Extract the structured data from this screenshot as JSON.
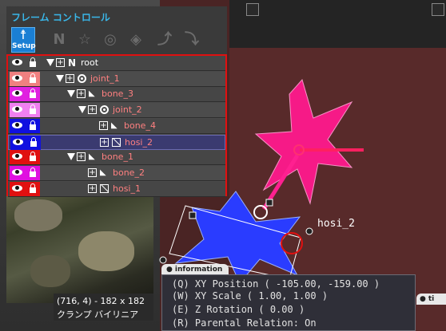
{
  "panel": {
    "title": "フレーム コントロール",
    "setup_label": "Setup",
    "toolbar_icons": [
      "new-null-icon",
      "new-star-icon",
      "new-joint-icon",
      "new-bone-icon",
      "import-icon",
      "export-icon"
    ]
  },
  "tree": {
    "rows": [
      {
        "label": "root",
        "type": "null",
        "color": "#4a4a4a",
        "text": "#ffffff",
        "expanded": true
      },
      {
        "label": "joint_1",
        "type": "joint",
        "color": "#f08080",
        "text": "#ff8080",
        "expanded": true
      },
      {
        "label": "bone_3",
        "type": "bone",
        "color": "#e020e0",
        "text": "#ff8080",
        "expanded": true
      },
      {
        "label": "joint_2",
        "type": "joint",
        "color": "#f080f0",
        "text": "#ff8080",
        "expanded": true
      },
      {
        "label": "bone_4",
        "type": "bone",
        "color": "#1010e0",
        "text": "#ff8080",
        "expanded": false
      },
      {
        "label": "hosi_2",
        "type": "mesh",
        "color": "#1010e0",
        "text": "#ff8080",
        "expanded": false,
        "selected": true
      },
      {
        "label": "bone_1",
        "type": "bone",
        "color": "#e01010",
        "text": "#ff8080",
        "expanded": true
      },
      {
        "label": "bone_2",
        "type": "bone",
        "color": "#e010e0",
        "text": "#ff8080",
        "expanded": false
      },
      {
        "label": "hosi_1",
        "type": "mesh",
        "color": "#e01010",
        "text": "#ff8080",
        "expanded": false
      }
    ]
  },
  "status": {
    "coords": "(716, 4) - 182 x 182",
    "mode": "クランプ バイリニア"
  },
  "info": {
    "tab_label": "information",
    "position": "(Q) XY Position ( -105.00, -159.00 )",
    "scale": "(W) XY Scale ( 1.00, 1.00 )",
    "rotation": "(E) Z Rotation ( 0.00 )",
    "relation": "(R) Parental Relation: On"
  },
  "right_tab": "ti",
  "canvas_label": "hosi_2",
  "colors": {
    "selection": "#e01010",
    "accent": "#39b6e8",
    "pink_star": "#ff2080",
    "blue_star": "#2040ff"
  }
}
